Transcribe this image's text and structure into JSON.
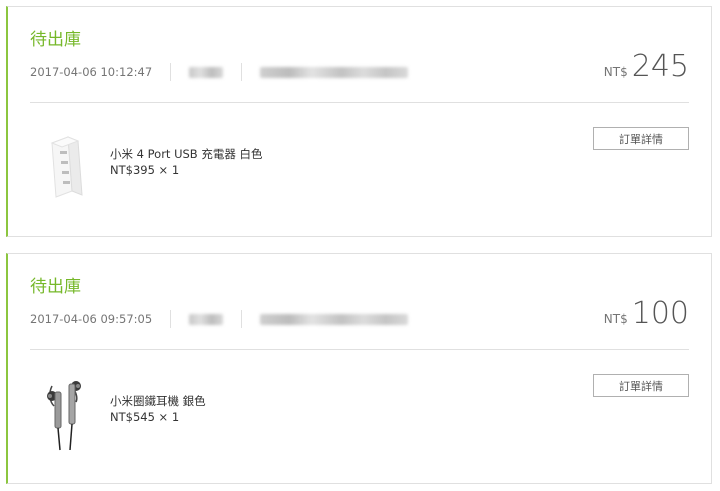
{
  "orders": [
    {
      "status": "待出庫",
      "date": "2017-04-06 10:12:47",
      "currency": "NT$",
      "total": "245",
      "item_name": "小米 4 Port USB 充電器 白色",
      "item_price": "NT$395 × 1",
      "detail_label": "訂單詳情"
    },
    {
      "status": "待出庫",
      "date": "2017-04-06 09:57:05",
      "currency": "NT$",
      "total": "100",
      "item_name": "小米圈鐵耳機 銀色",
      "item_price": "NT$545 × 1",
      "detail_label": "訂單詳情"
    }
  ],
  "colors": {
    "accent": "#76b82a",
    "border_accent": "#8cc63f"
  }
}
